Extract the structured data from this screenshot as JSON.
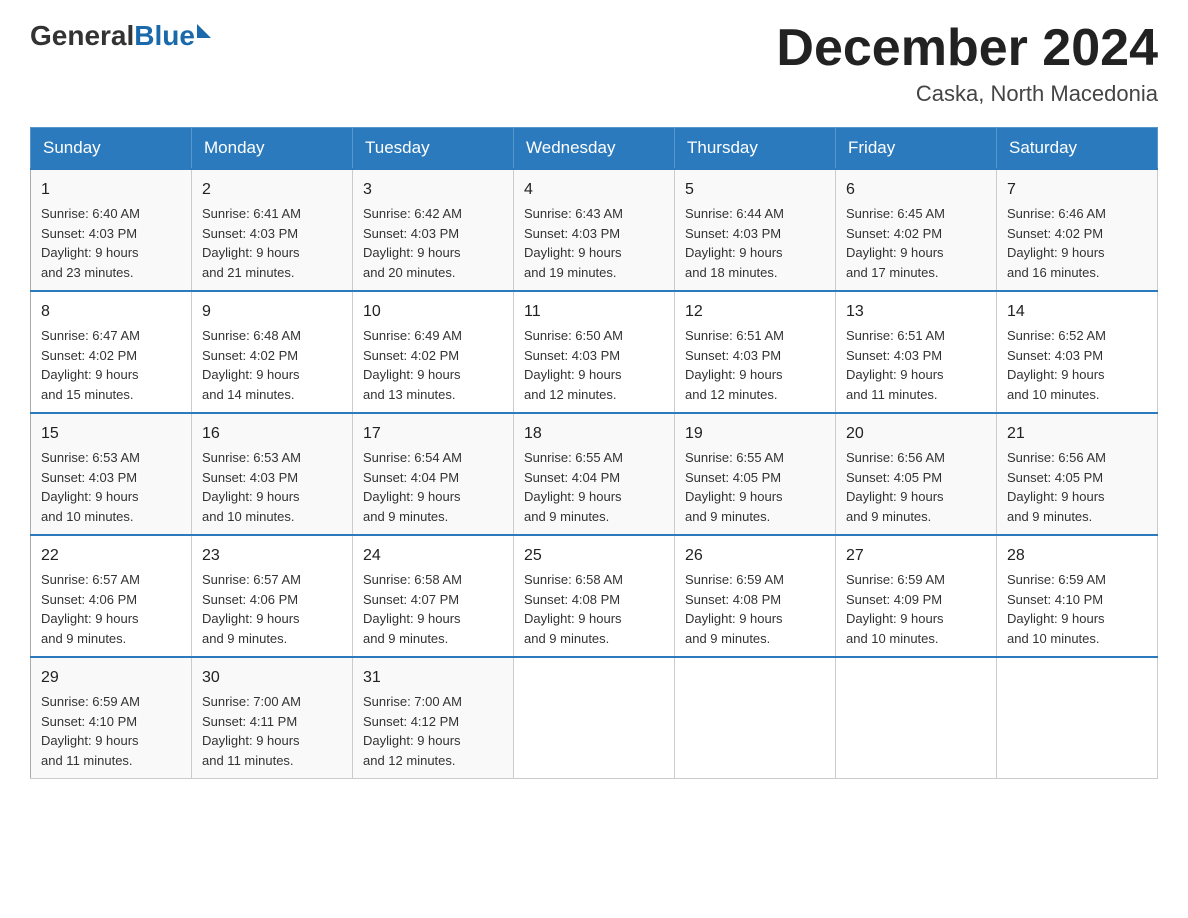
{
  "header": {
    "logo": {
      "general": "General",
      "blue": "Blue"
    },
    "title": "December 2024",
    "location": "Caska, North Macedonia"
  },
  "weekdays": [
    "Sunday",
    "Monday",
    "Tuesday",
    "Wednesday",
    "Thursday",
    "Friday",
    "Saturday"
  ],
  "weeks": [
    [
      {
        "day": "1",
        "sunrise": "6:40 AM",
        "sunset": "4:03 PM",
        "daylight": "9 hours and 23 minutes."
      },
      {
        "day": "2",
        "sunrise": "6:41 AM",
        "sunset": "4:03 PM",
        "daylight": "9 hours and 21 minutes."
      },
      {
        "day": "3",
        "sunrise": "6:42 AM",
        "sunset": "4:03 PM",
        "daylight": "9 hours and 20 minutes."
      },
      {
        "day": "4",
        "sunrise": "6:43 AM",
        "sunset": "4:03 PM",
        "daylight": "9 hours and 19 minutes."
      },
      {
        "day": "5",
        "sunrise": "6:44 AM",
        "sunset": "4:03 PM",
        "daylight": "9 hours and 18 minutes."
      },
      {
        "day": "6",
        "sunrise": "6:45 AM",
        "sunset": "4:02 PM",
        "daylight": "9 hours and 17 minutes."
      },
      {
        "day": "7",
        "sunrise": "6:46 AM",
        "sunset": "4:02 PM",
        "daylight": "9 hours and 16 minutes."
      }
    ],
    [
      {
        "day": "8",
        "sunrise": "6:47 AM",
        "sunset": "4:02 PM",
        "daylight": "9 hours and 15 minutes."
      },
      {
        "day": "9",
        "sunrise": "6:48 AM",
        "sunset": "4:02 PM",
        "daylight": "9 hours and 14 minutes."
      },
      {
        "day": "10",
        "sunrise": "6:49 AM",
        "sunset": "4:02 PM",
        "daylight": "9 hours and 13 minutes."
      },
      {
        "day": "11",
        "sunrise": "6:50 AM",
        "sunset": "4:03 PM",
        "daylight": "9 hours and 12 minutes."
      },
      {
        "day": "12",
        "sunrise": "6:51 AM",
        "sunset": "4:03 PM",
        "daylight": "9 hours and 12 minutes."
      },
      {
        "day": "13",
        "sunrise": "6:51 AM",
        "sunset": "4:03 PM",
        "daylight": "9 hours and 11 minutes."
      },
      {
        "day": "14",
        "sunrise": "6:52 AM",
        "sunset": "4:03 PM",
        "daylight": "9 hours and 10 minutes."
      }
    ],
    [
      {
        "day": "15",
        "sunrise": "6:53 AM",
        "sunset": "4:03 PM",
        "daylight": "9 hours and 10 minutes."
      },
      {
        "day": "16",
        "sunrise": "6:53 AM",
        "sunset": "4:03 PM",
        "daylight": "9 hours and 10 minutes."
      },
      {
        "day": "17",
        "sunrise": "6:54 AM",
        "sunset": "4:04 PM",
        "daylight": "9 hours and 9 minutes."
      },
      {
        "day": "18",
        "sunrise": "6:55 AM",
        "sunset": "4:04 PM",
        "daylight": "9 hours and 9 minutes."
      },
      {
        "day": "19",
        "sunrise": "6:55 AM",
        "sunset": "4:05 PM",
        "daylight": "9 hours and 9 minutes."
      },
      {
        "day": "20",
        "sunrise": "6:56 AM",
        "sunset": "4:05 PM",
        "daylight": "9 hours and 9 minutes."
      },
      {
        "day": "21",
        "sunrise": "6:56 AM",
        "sunset": "4:05 PM",
        "daylight": "9 hours and 9 minutes."
      }
    ],
    [
      {
        "day": "22",
        "sunrise": "6:57 AM",
        "sunset": "4:06 PM",
        "daylight": "9 hours and 9 minutes."
      },
      {
        "day": "23",
        "sunrise": "6:57 AM",
        "sunset": "4:06 PM",
        "daylight": "9 hours and 9 minutes."
      },
      {
        "day": "24",
        "sunrise": "6:58 AM",
        "sunset": "4:07 PM",
        "daylight": "9 hours and 9 minutes."
      },
      {
        "day": "25",
        "sunrise": "6:58 AM",
        "sunset": "4:08 PM",
        "daylight": "9 hours and 9 minutes."
      },
      {
        "day": "26",
        "sunrise": "6:59 AM",
        "sunset": "4:08 PM",
        "daylight": "9 hours and 9 minutes."
      },
      {
        "day": "27",
        "sunrise": "6:59 AM",
        "sunset": "4:09 PM",
        "daylight": "9 hours and 10 minutes."
      },
      {
        "day": "28",
        "sunrise": "6:59 AM",
        "sunset": "4:10 PM",
        "daylight": "9 hours and 10 minutes."
      }
    ],
    [
      {
        "day": "29",
        "sunrise": "6:59 AM",
        "sunset": "4:10 PM",
        "daylight": "9 hours and 11 minutes."
      },
      {
        "day": "30",
        "sunrise": "7:00 AM",
        "sunset": "4:11 PM",
        "daylight": "9 hours and 11 minutes."
      },
      {
        "day": "31",
        "sunrise": "7:00 AM",
        "sunset": "4:12 PM",
        "daylight": "9 hours and 12 minutes."
      },
      null,
      null,
      null,
      null
    ]
  ],
  "labels": {
    "sunrise": "Sunrise:",
    "sunset": "Sunset:",
    "daylight": "Daylight:"
  }
}
